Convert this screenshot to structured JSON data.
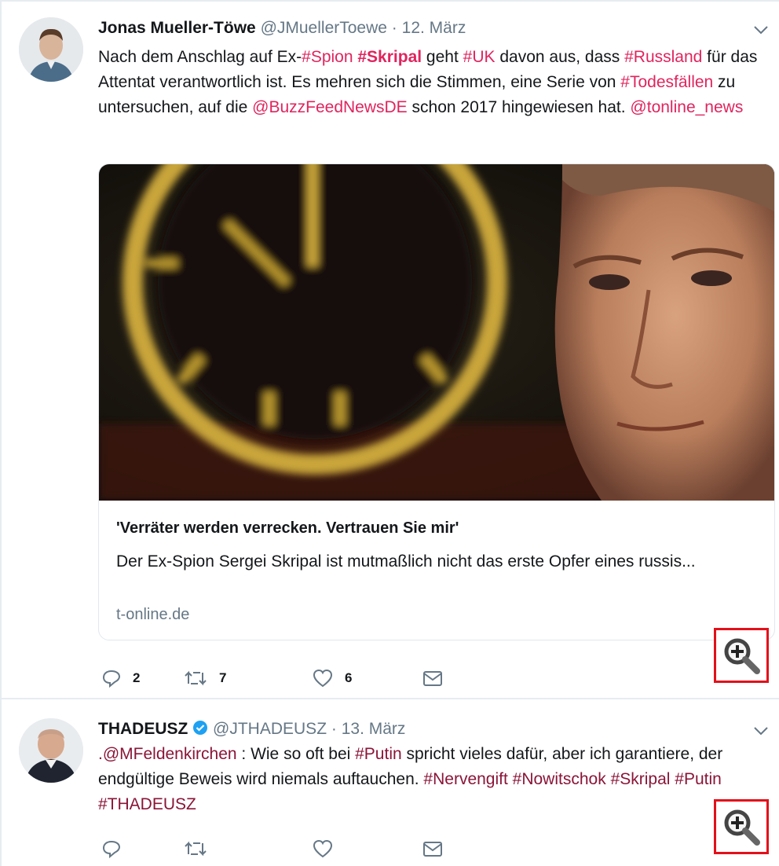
{
  "tweets": [
    {
      "author": "Jonas Mueller-Töwe",
      "handle": "@JMuellerToewe",
      "separator": "·",
      "date": "12. März",
      "text": {
        "t1": "Nach dem Anschlag auf Ex-",
        "h_spion": "#Spion",
        "t2": " ",
        "h_skripal": "#Skripal",
        "t3": " geht ",
        "h_uk": "#UK",
        "t4": " davon aus, dass ",
        "h_russland": "#Russland",
        "t5": " für das Attentat verantwortlich ist. Es mehren sich die Stimmen, eine Serie von ",
        "h_todes": "#Todesfällen",
        "t6": " zu  untersuchen, auf die ",
        "m_buzz": "@BuzzFeedNewsDE",
        "t7": " schon 2017 hingewiesen hat. ",
        "m_tonline": "@tonline_news"
      },
      "card": {
        "title": "'Verräter werden verrecken. Vertrauen Sie mir'",
        "description": "Der Ex-Spion Sergei Skripal ist mutmaßlich nicht das erste Opfer eines russis...",
        "domain": "t-online.de"
      },
      "actions": {
        "replies": "2",
        "retweets": "7",
        "likes": "6"
      }
    },
    {
      "author": "THADEUSZ",
      "handle": "@JTHADEUSZ",
      "separator": "·",
      "date": "13. März",
      "text": {
        "m_felden": ".@MFeldenkirchen",
        "t1": " : Wie so oft bei ",
        "h_putin1": "#Putin",
        "t2": " spricht vieles dafür, aber ich garantiere, der endgültige Beweis wird niemals auftauchen. ",
        "h_nerven": "#Nervengift",
        "t3": " ",
        "h_nowit": "#Nowitschok",
        "t4": " ",
        "h_skripal": "#Skripal",
        "t5": " ",
        "h_putin2": "#Putin",
        "t6": " ",
        "h_thad": "#THADEUSZ"
      },
      "actions": {
        "replies": "",
        "retweets": "",
        "likes": ""
      }
    }
  ],
  "icons": {
    "reply": "reply-icon",
    "retweet": "retweet-icon",
    "like": "heart-icon",
    "dm": "envelope-icon",
    "more": "chevron-down-icon",
    "zoom": "zoom-in-icon",
    "verified": "verified-badge-icon"
  },
  "colors": {
    "hashtag": "#e0245e",
    "hashtag_dark": "#8a1538",
    "handle": "#657786",
    "zoom_border": "#e3101a",
    "verified": "#1da1f2"
  }
}
